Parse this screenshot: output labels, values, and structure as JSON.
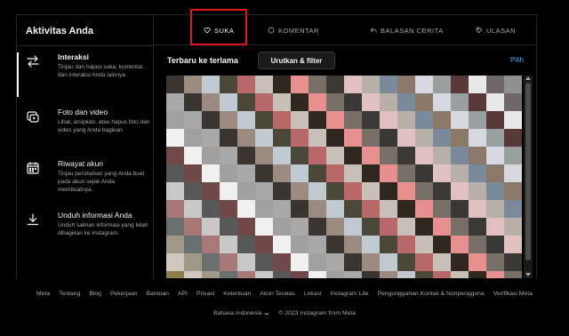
{
  "sidebar": {
    "title": "Aktivitas Anda",
    "items": [
      {
        "label": "Interaksi",
        "desc": "Tinjau dan hapus suka, komentar, dan interaksi Anda lainnya.",
        "icon": "interactions-icon",
        "active": true
      },
      {
        "label": "Foto dan video",
        "desc": "Lihat, arsipkan, atau hapus foto dan video yang Anda bagikan.",
        "icon": "photos-videos-icon",
        "active": false
      },
      {
        "label": "Riwayat akun",
        "desc": "Tinjau perubahan yang Anda buat pada akun sejak Anda membuatnya.",
        "icon": "calendar-icon",
        "active": false
      },
      {
        "label": "Unduh informasi Anda",
        "desc": "Unduh salinan informasi yang telah dibagikan ke Instagram.",
        "icon": "download-icon",
        "active": false
      }
    ]
  },
  "tabs": [
    {
      "label": "SUKA",
      "icon": "heart-icon",
      "active": true
    },
    {
      "label": "KOMENTAR",
      "icon": "comment-icon",
      "active": false
    },
    {
      "label": "BALASAN CERITA",
      "icon": "reply-icon",
      "active": false
    },
    {
      "label": "ULASAN",
      "icon": "review-icon",
      "active": false
    }
  ],
  "toolbar": {
    "sort_label": "Terbaru ke terlama",
    "sort_button": "Urutkan & filter",
    "select_label": "Pilih"
  },
  "footer": {
    "links": [
      "Meta",
      "Tentang",
      "Blog",
      "Pekerjaan",
      "Bantuan",
      "API",
      "Privasi",
      "Ketentuan",
      "Akun Teratas",
      "Lokasi",
      "Instagram Lite",
      "Pengunggahan Kontak & Nonpengguna",
      "Verifikasi Meta"
    ],
    "language": "Bahasa Indonesia",
    "copyright": "© 2023 Instagram from Meta"
  },
  "colors": {
    "highlight": "#e0191c",
    "link": "#4aa3f0"
  },
  "thumbnail_palette": [
    "#3a3530",
    "#c9d4e6",
    "#d8cc9c",
    "#8f7c4a",
    "#7a8a9a",
    "#b8b0a8",
    "#6b5a50",
    "#9a8a80",
    "#c8b8b0",
    "#a89a8a",
    "#d0c8c0",
    "#8a7868",
    "#4a4038",
    "#a8b0b8",
    "#c0c8d0",
    "#e8e0d8",
    "#3c3a36",
    "#a29888",
    "#d8d8e0",
    "#b0b8c8",
    "#2a2622",
    "#4a4838",
    "#8a8878",
    "#c8c0a0",
    "#6a7070",
    "#9aa0a0",
    "#303838",
    "#8a5858",
    "#b86868",
    "#d89898",
    "#c8a8a8",
    "#a87878",
    "#583838",
    "#787070",
    "#a89898",
    "#c8c0b8",
    "#606058",
    "#888078",
    "#c8c8c8",
    "#e8e8e8",
    "#1a1816",
    "#5a4030",
    "#302820",
    "#4a4a40",
    "#7a7878",
    "#585858",
    "#706868",
    "#a84040",
    "#c86060",
    "#e89090",
    "#d8b0b0",
    "#b88888",
    "#704848",
    "#909090",
    "#b0a8a0",
    "#d0c8c0",
    "#787068",
    "#a09890",
    "#d8d0c8",
    "#f0f0f0",
    "#181818",
    "#403838",
    "#282420",
    "#3a3834",
    "#686060",
    "#888080",
    "#a0a0a0",
    "#c03838",
    "#d85050",
    "#e87070",
    "#e0c0c0",
    "#c09898",
    "#885858",
    "#a8a8a8",
    "#c0b8b0",
    "#e0d8d0",
    "#908880",
    "#b8b0a8",
    "#e0d8d0",
    "#f8f8f8"
  ]
}
